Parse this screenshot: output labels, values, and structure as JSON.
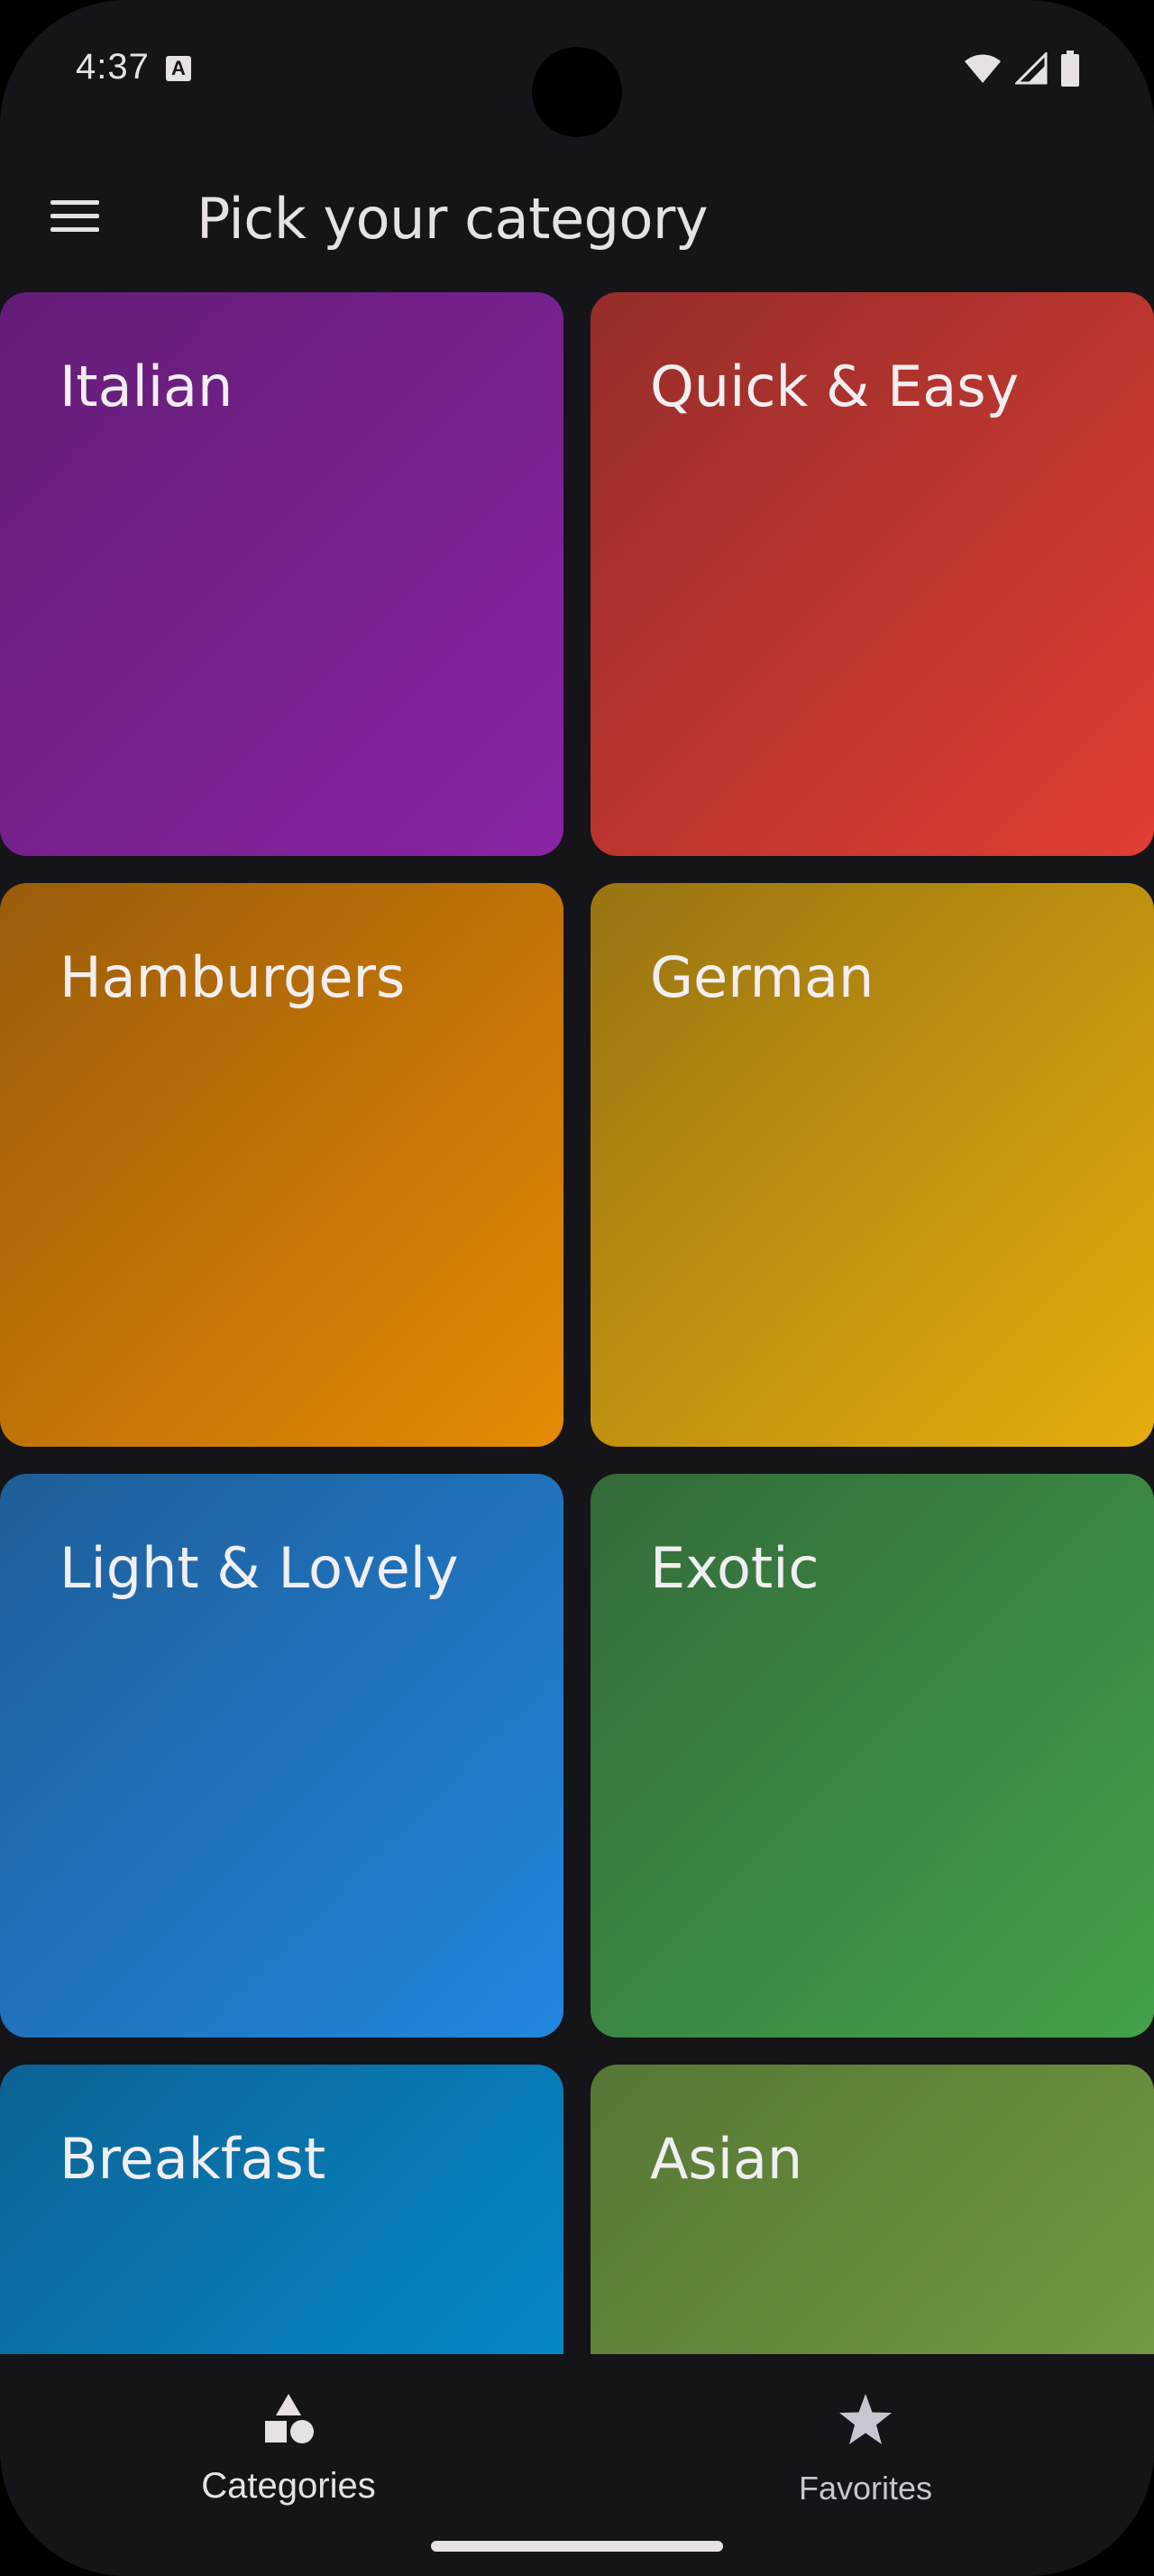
{
  "status_bar": {
    "time": "4:37",
    "icons": [
      "text-a-notification-icon",
      "wifi-icon",
      "cell-signal-icon",
      "battery-icon"
    ]
  },
  "app_bar": {
    "menu_icon": "hamburger-menu-icon",
    "title": "Pick your category"
  },
  "categories": [
    {
      "label": "Italian",
      "color_start": "#631d76",
      "color_end": "#8a24a4"
    },
    {
      "label": "Quick & Easy",
      "color_start": "#952d2a",
      "color_end": "#e03e33"
    },
    {
      "label": "Hamburgers",
      "color_start": "#9b5c0a",
      "color_end": "#e58a03"
    },
    {
      "label": "German",
      "color_start": "#987412",
      "color_end": "#e5ad0c"
    },
    {
      "label": "Light & Lovely",
      "color_start": "#1e5e98",
      "color_end": "#2187df"
    },
    {
      "label": "Exotic",
      "color_start": "#336b3a",
      "color_end": "#43a24a"
    },
    {
      "label": "Breakfast",
      "color_start": "#0c6394",
      "color_end": "#0394d8"
    },
    {
      "label": "Asian",
      "color_start": "#567735",
      "color_end": "#7ba344"
    }
  ],
  "bottom_nav": {
    "items": [
      {
        "label": "Categories",
        "icon": "category-shapes-icon",
        "selected": true
      },
      {
        "label": "Favorites",
        "icon": "star-icon",
        "selected": false
      }
    ]
  }
}
